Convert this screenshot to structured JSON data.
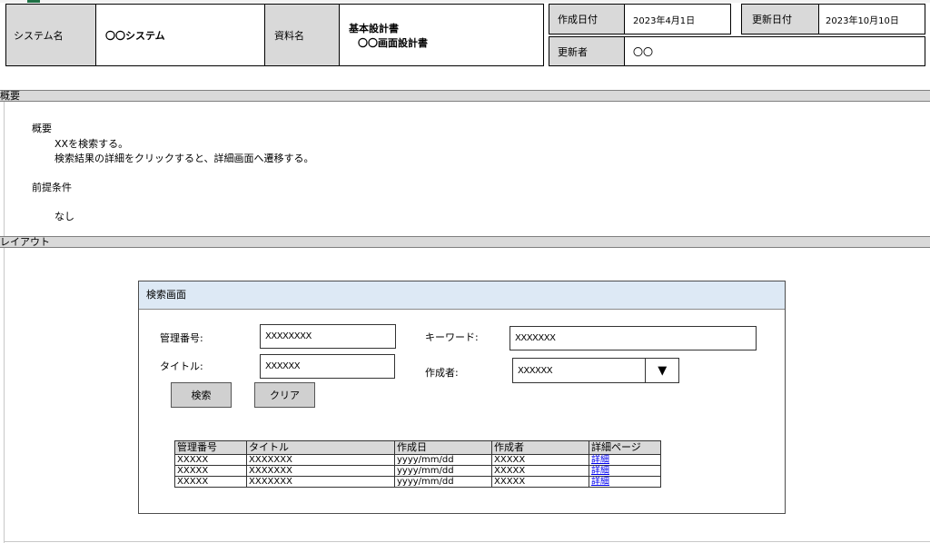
{
  "header": {
    "system_label": "システム名",
    "system_value": "〇〇システム",
    "doc_label": "資料名",
    "doc_value_line1": "基本設計書",
    "doc_value_line2": "〇〇画面設計書",
    "created_label": "作成日付",
    "created_value": "2023年4月1日",
    "updated_label": "更新日付",
    "updated_value": "2023年10月10日",
    "updater_label": "更新者",
    "updater_value": "〇〇"
  },
  "overview": {
    "section_title": "概要",
    "heading": "概要",
    "line1": "XXを検索する。",
    "line2": "検索結果の詳細をクリックすると、詳細画面へ遷移する。",
    "precondition_heading": "前提条件",
    "precondition_value": "なし"
  },
  "layout": {
    "section_title": "レイアウト",
    "screen_title": "検索画面",
    "form": {
      "mgmt_no_label": "管理番号:",
      "mgmt_no_value": "XXXXXXXX",
      "title_label": "タイトル:",
      "title_value": "XXXXXX",
      "keyword_label": "キーワード:",
      "keyword_value": "XXXXXXX",
      "author_label": "作成者:",
      "author_value": "XXXXXX",
      "dropdown_glyph": "▼",
      "search_button": "検索",
      "clear_button": "クリア"
    },
    "table": {
      "headers": [
        "管理番号",
        "タイトル",
        "作成日",
        "作成者",
        "詳細ページ"
      ],
      "rows": [
        [
          "XXXXX",
          "XXXXXXX",
          "yyyy/mm/dd",
          "XXXXX",
          "詳細"
        ],
        [
          "XXXXX",
          "XXXXXXX",
          "yyyy/mm/dd",
          "XXXXX",
          "詳細"
        ],
        [
          "XXXXX",
          "XXXXXXX",
          "yyyy/mm/dd",
          "XXXXX",
          "詳細"
        ]
      ]
    }
  }
}
